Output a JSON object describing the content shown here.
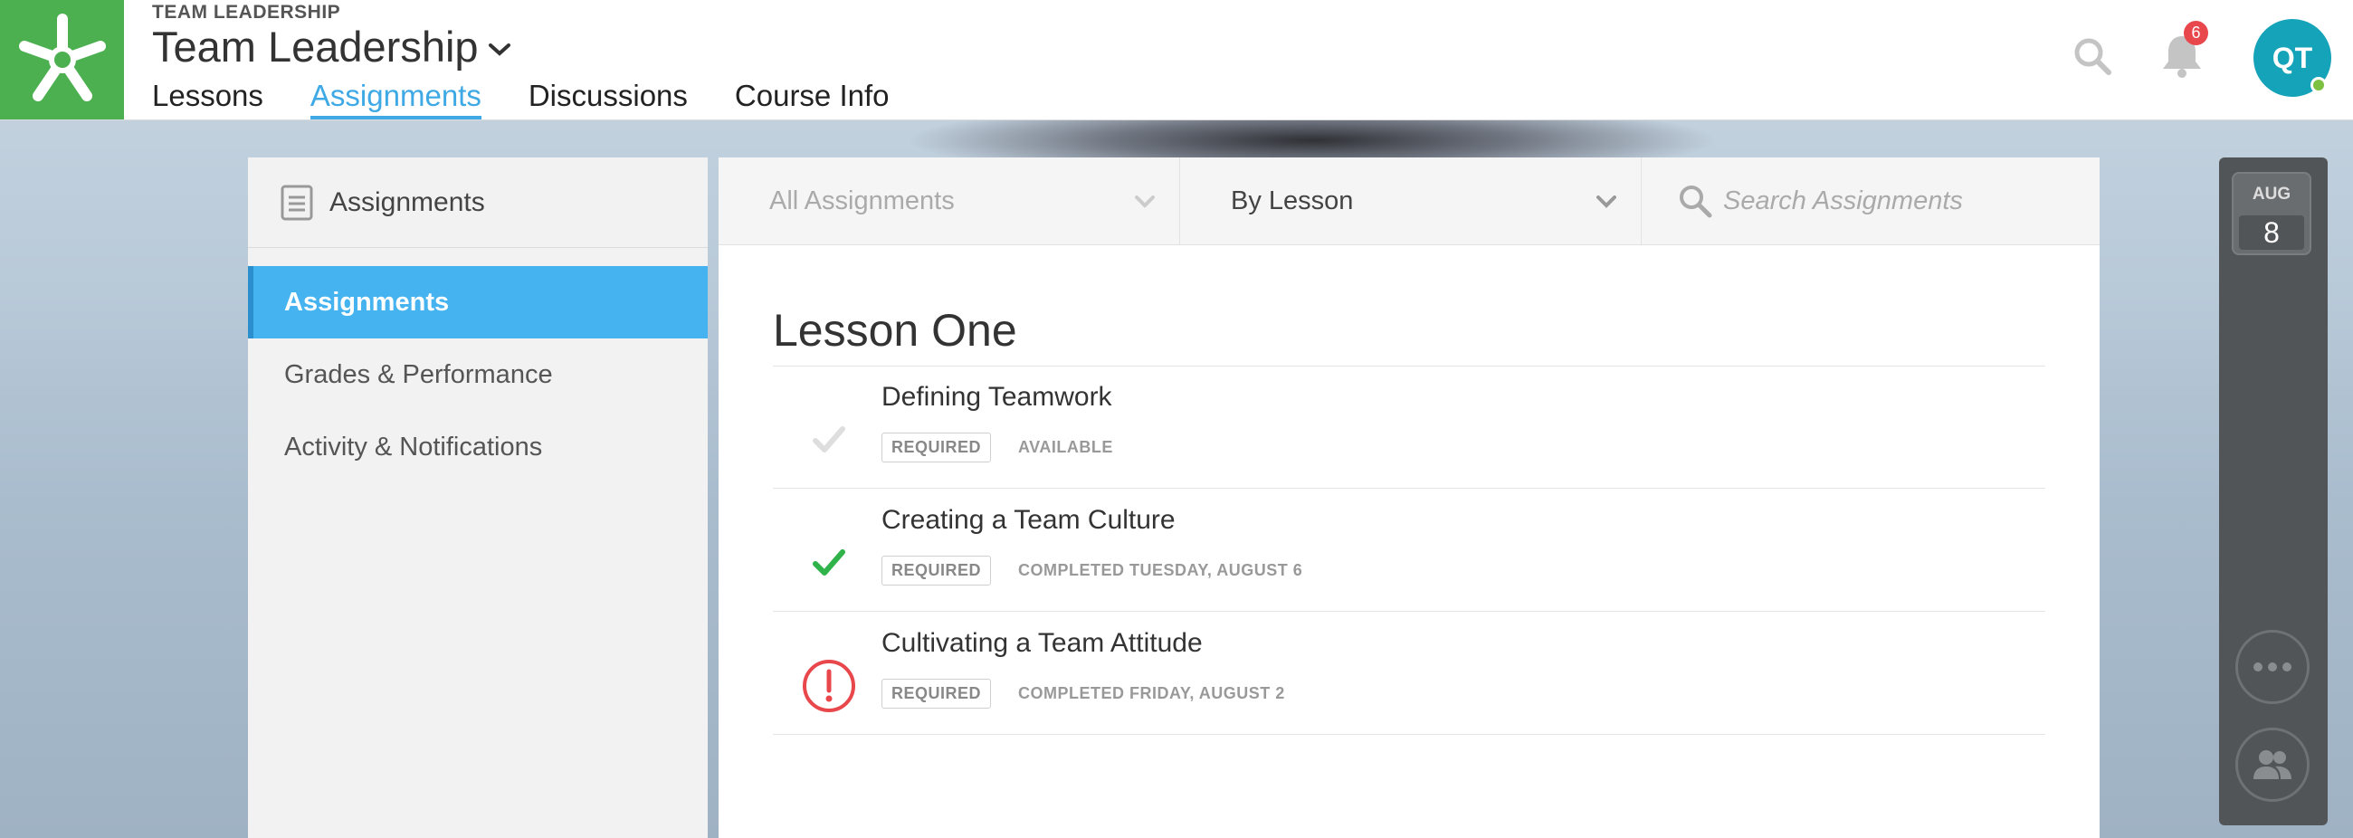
{
  "header": {
    "kicker": "TEAM LEADERSHIP",
    "course_title": "Team Leadership",
    "nav": [
      {
        "label": "Lessons",
        "active": false
      },
      {
        "label": "Assignments",
        "active": true
      },
      {
        "label": "Discussions",
        "active": false
      },
      {
        "label": "Course Info",
        "active": false
      }
    ],
    "notification_count": "6",
    "avatar_initials": "QT"
  },
  "sidebar": {
    "title": "Assignments",
    "items": [
      {
        "label": "Assignments",
        "active": true
      },
      {
        "label": "Grades & Performance",
        "active": false
      },
      {
        "label": "Activity & Notifications",
        "active": false
      }
    ]
  },
  "filters": {
    "type_filter": "All Assignments",
    "group_filter": "By Lesson",
    "search_placeholder": "Search Assignments"
  },
  "lesson": {
    "title": "Lesson One",
    "assignments": [
      {
        "name": "Defining Teamwork",
        "tag": "REQUIRED",
        "status": "AVAILABLE",
        "state": "pending"
      },
      {
        "name": "Creating a Team Culture",
        "tag": "REQUIRED",
        "status": "COMPLETED TUESDAY, AUGUST 6",
        "state": "completed"
      },
      {
        "name": "Cultivating a Team Attitude",
        "tag": "REQUIRED",
        "status": "COMPLETED FRIDAY, AUGUST 2",
        "state": "late"
      }
    ]
  },
  "dock": {
    "month": "AUG",
    "day": "8"
  },
  "colors": {
    "brand_green": "#4cb050",
    "accent_blue": "#3fa9e5",
    "success_green": "#2fb34a",
    "alert_red": "#e8474c",
    "avatar_teal": "#14a3b8"
  }
}
